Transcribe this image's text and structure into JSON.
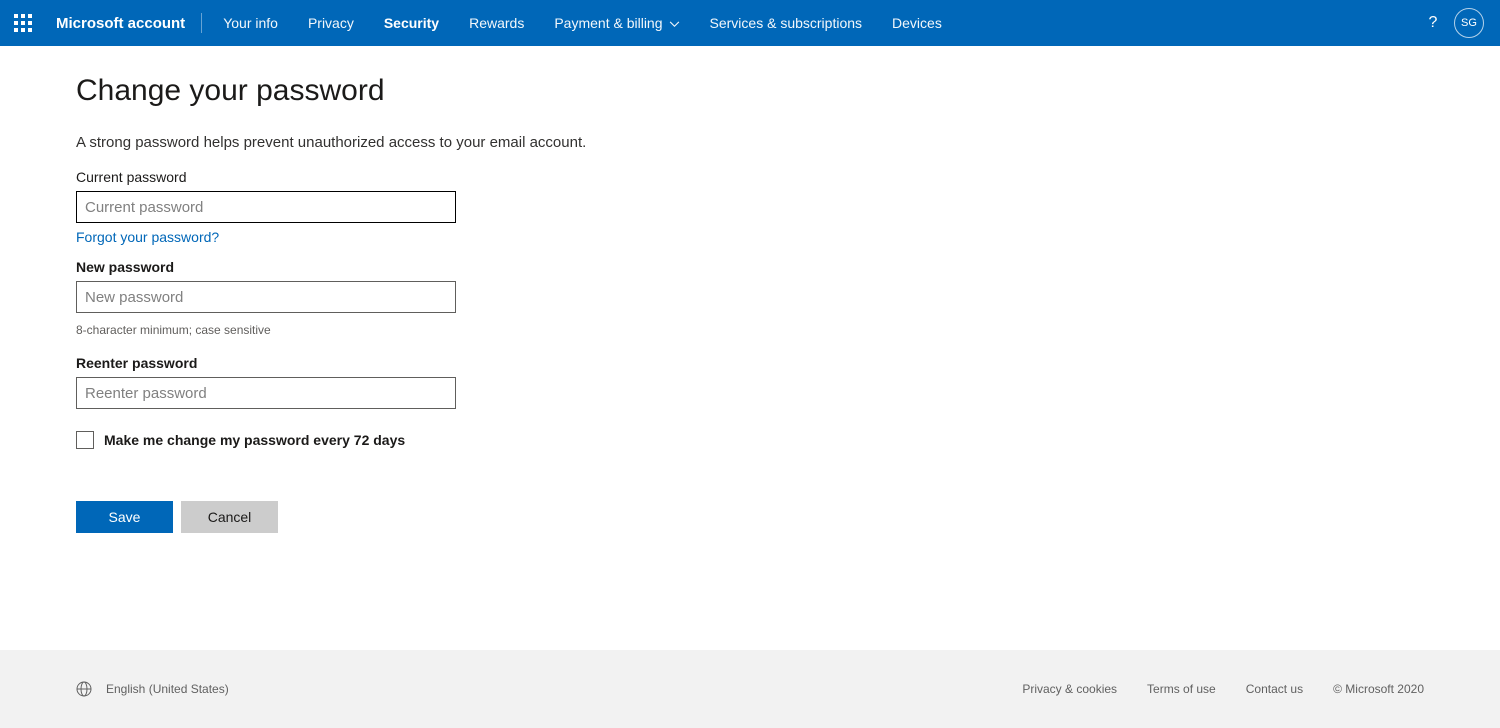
{
  "header": {
    "brand": "Microsoft account",
    "nav": [
      {
        "label": "Your info",
        "active": false,
        "hasDropdown": false
      },
      {
        "label": "Privacy",
        "active": false,
        "hasDropdown": false
      },
      {
        "label": "Security",
        "active": true,
        "hasDropdown": false
      },
      {
        "label": "Rewards",
        "active": false,
        "hasDropdown": false
      },
      {
        "label": "Payment & billing",
        "active": false,
        "hasDropdown": true
      },
      {
        "label": "Services & subscriptions",
        "active": false,
        "hasDropdown": false
      },
      {
        "label": "Devices",
        "active": false,
        "hasDropdown": false
      }
    ],
    "avatarInitials": "SG"
  },
  "page": {
    "title": "Change your password",
    "subtitle": "A strong password helps prevent unauthorized access to your email account.",
    "currentPassword": {
      "label": "Current password",
      "placeholder": "Current password",
      "value": ""
    },
    "forgotLink": "Forgot your password?",
    "newPassword": {
      "label": "New password",
      "placeholder": "New password",
      "value": "",
      "hint": "8-character minimum; case sensitive"
    },
    "reenterPassword": {
      "label": "Reenter password",
      "placeholder": "Reenter password",
      "value": ""
    },
    "checkbox": {
      "label": "Make me change my password every 72 days",
      "checked": false
    },
    "buttons": {
      "save": "Save",
      "cancel": "Cancel"
    }
  },
  "footer": {
    "language": "English (United States)",
    "links": [
      "Privacy & cookies",
      "Terms of use",
      "Contact us"
    ],
    "copyright": "© Microsoft 2020"
  }
}
